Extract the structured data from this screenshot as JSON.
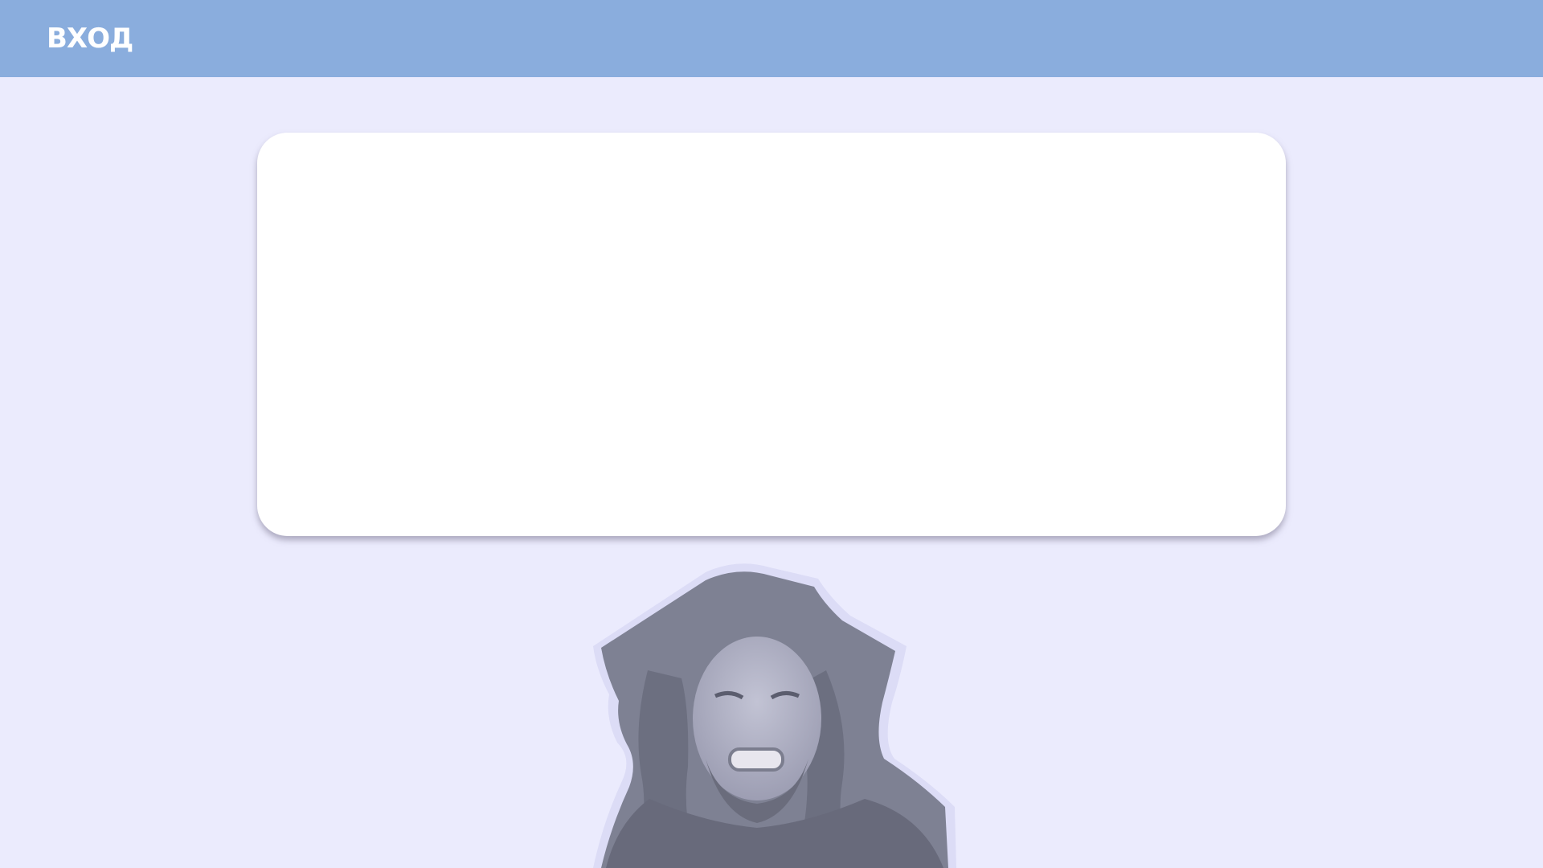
{
  "header": {
    "title": "ВХОД",
    "background_color": "#8aaddd"
  },
  "page": {
    "background_color": "#ebebfd"
  },
  "panel": {
    "background_color": "#ffffff"
  },
  "sticker": {
    "description_icon": "person-sticker-icon"
  }
}
